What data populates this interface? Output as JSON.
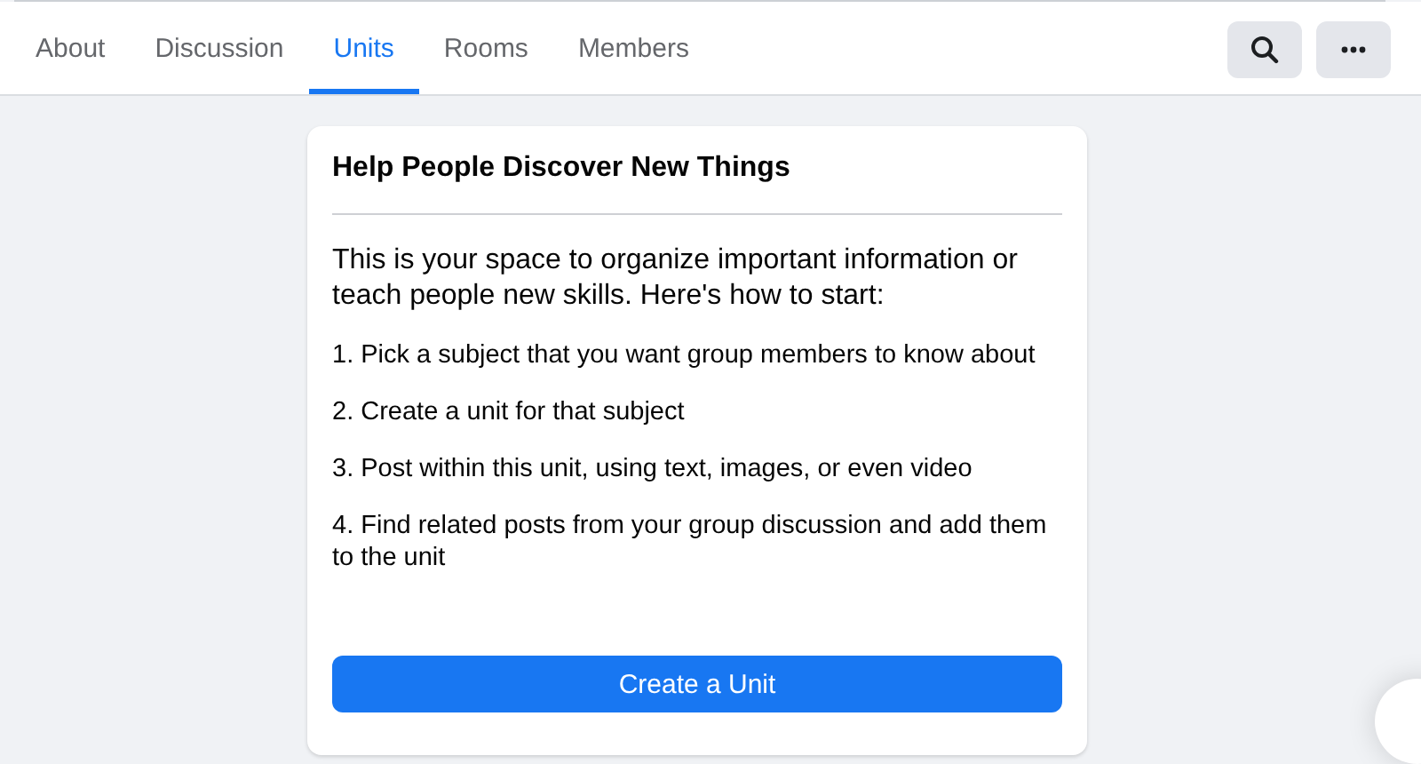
{
  "tabs": [
    {
      "label": "About",
      "selected": false
    },
    {
      "label": "Discussion",
      "selected": false
    },
    {
      "label": "Units",
      "selected": true
    },
    {
      "label": "Rooms",
      "selected": false
    },
    {
      "label": "Members",
      "selected": false
    }
  ],
  "card": {
    "title": "Help People Discover New Things",
    "intro": "This is your space to organize important information or teach people new skills. Here's how to start:",
    "steps": [
      "1. Pick a subject that you want group members to know about",
      "2. Create a unit for that subject",
      "3. Post within this unit, using text, images, or even video",
      "4. Find related posts from your group discussion and add them to the unit"
    ],
    "button": "Create a Unit"
  }
}
